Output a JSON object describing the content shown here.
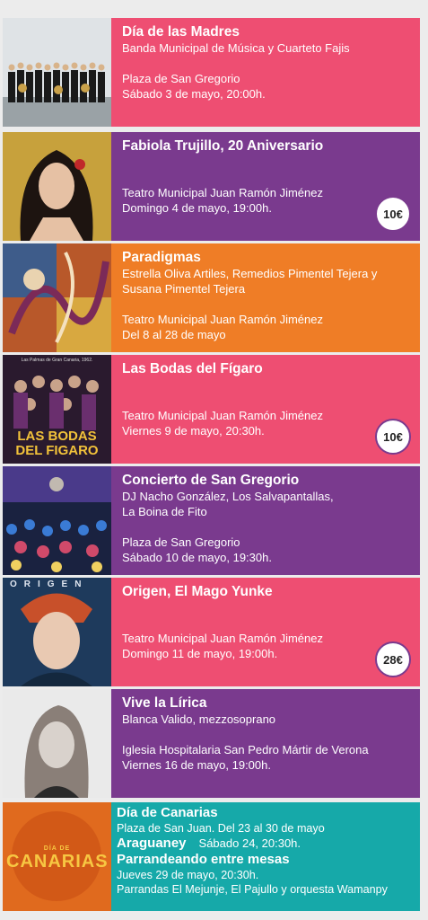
{
  "events": [
    {
      "title": "Día de las Madres",
      "lines": [
        "Banda Municipal de Música y Cuarteto Fajis",
        "",
        "Plaza de San Gregorio",
        "Sábado 3 de mayo, 20:00h."
      ],
      "color": "#ee4e72",
      "image": "band-photo"
    },
    {
      "title": "Fabiola Trujillo, 20 Aniversario",
      "lines": [
        "",
        "",
        "Teatro Municipal Juan Ramón Jiménez",
        "Domingo 4 de mayo, 19:00h."
      ],
      "price": "10€",
      "color": "#7a3a8e",
      "image": "singer-portrait"
    },
    {
      "title": "Paradigmas",
      "lines": [
        "Estrella Oliva Artiles, Remedios Pimentel Tejera y",
        "Susana Pimentel Tejera",
        "",
        "Teatro Municipal Juan Ramón Jiménez",
        "Del 8 al 28 de mayo"
      ],
      "color": "#ef7d26",
      "image": "abstract-painting"
    },
    {
      "title": "Las Bodas del Fígaro",
      "lines": [
        "",
        "",
        "Teatro Municipal Juan Ramón Jiménez",
        "Viernes 9 de mayo, 20:30h."
      ],
      "price": "10€",
      "color": "#ee4e72",
      "image_top_text": "Las Palmas de Gran Canaria, 1962.",
      "image_text": "LAS BODAS DEL FIGARO"
    },
    {
      "title": "Concierto de San Gregorio",
      "lines": [
        "DJ Nacho González, Los Salvapantallas,",
        "La Boina de Fito",
        "",
        "Plaza de San Gregorio",
        "Sábado 10 de mayo, 19:30h."
      ],
      "color": "#7a3a8e",
      "image": "crowd-photo"
    },
    {
      "title": "Origen, El Mago Yunke",
      "lines": [
        "",
        "",
        "Teatro Municipal Juan Ramón Jiménez",
        "Domingo 11 de mayo, 19:00h."
      ],
      "price": "28€",
      "color": "#ee4e72",
      "image_text": "ORIGEN"
    },
    {
      "title": "Vive la Lírica",
      "lines": [
        "Blanca Valido, mezzosoprano",
        "",
        "Iglesia Hospitalaria San Pedro Mártir de Verona",
        "Viernes 16 de mayo, 19:00h."
      ],
      "color": "#7a3a8e",
      "image": "soprano-portrait"
    }
  ],
  "canarias": {
    "color": "#16a9a9",
    "image_small": "DÍA DE",
    "image_big": "CANARIAS",
    "title1": "Día de Canarias",
    "line1": "Plaza de San Juan. Del 23 al 30 de mayo",
    "title2": "Araguaney",
    "line2": "Sábado 24, 20:30h.",
    "title3": "Parrandeando entre mesas",
    "line3": "Jueves 29 de mayo, 20:30h.",
    "line4": "Parrandas El Mejunje, El Pajullo y orquesta Wamanpy"
  }
}
